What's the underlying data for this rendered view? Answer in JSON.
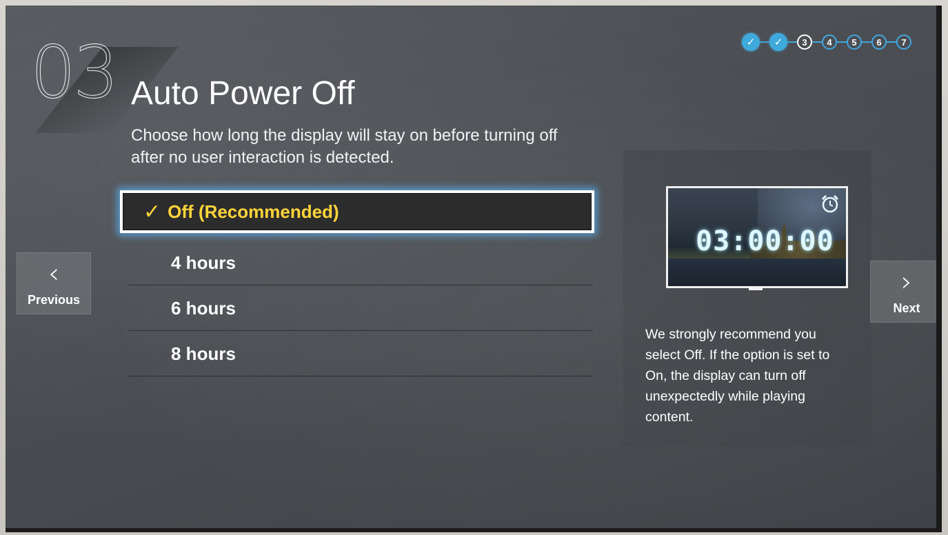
{
  "step": {
    "number": "03",
    "title": "Auto Power Off",
    "description": "Choose how long the display will stay on before turning off after no user interaction is detected."
  },
  "progress": {
    "steps": [
      {
        "label": "",
        "state": "done"
      },
      {
        "label": "",
        "state": "done"
      },
      {
        "label": "3",
        "state": "current"
      },
      {
        "label": "4",
        "state": "todo"
      },
      {
        "label": "5",
        "state": "todo"
      },
      {
        "label": "6",
        "state": "todo"
      },
      {
        "label": "7",
        "state": "todo"
      }
    ]
  },
  "options": {
    "selected_mark": "✓",
    "items": [
      {
        "label": "Off (Recommended)",
        "selected": true
      },
      {
        "label": "4 hours",
        "selected": false
      },
      {
        "label": "6 hours",
        "selected": false
      },
      {
        "label": "8 hours",
        "selected": false
      }
    ]
  },
  "preview": {
    "clock": "03:00:00",
    "icon": "alarm-clock-icon"
  },
  "info": {
    "text": "We strongly recommend you select Off. If the option is set to On, the display can turn off unexpectedly while playing content."
  },
  "nav": {
    "previous_label": "Previous",
    "next_label": "Next",
    "previous_icon": "chevron-left-icon",
    "next_icon": "chevron-right-icon"
  },
  "colors": {
    "accent_blue": "#3fa9dc",
    "selected_text": "#ffd43a",
    "background": "#4b4e53"
  }
}
